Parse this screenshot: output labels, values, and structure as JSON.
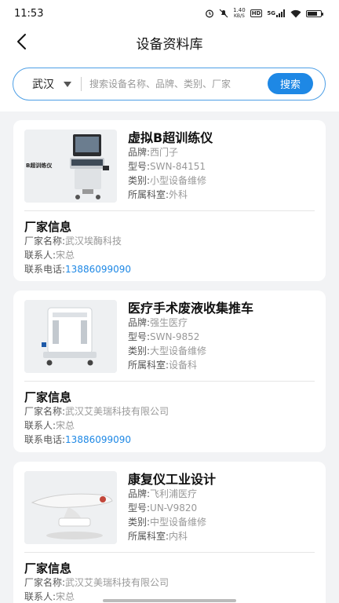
{
  "status": {
    "time": "11:53",
    "speed": "1.40",
    "speed_unit": "KB/S",
    "hd": "HD",
    "network": "5G"
  },
  "header": {
    "title": "设备资料库"
  },
  "search": {
    "city": "武汉",
    "placeholder": "搜索设备名称、品牌、类别、厂家",
    "button_label": "搜索"
  },
  "labels": {
    "brand": "品牌:",
    "model": "型号:",
    "category": "类别:",
    "department": "所属科室:",
    "vendor_section": "厂家信息",
    "vendor_name": "厂家名称:",
    "contact": "联系人:",
    "phone": "联系电话:"
  },
  "products": [
    {
      "name": "虚拟B超训练仪",
      "image_caption": "B超训练仪",
      "brand": "西门子",
      "model": "SWN-84151",
      "category": "小型设备维修",
      "department": "外科",
      "vendor": {
        "name": "武汉埃酶科技",
        "contact": "宋总",
        "phone": "13886099090"
      }
    },
    {
      "name": "医疗手术废液收集推车",
      "brand": "强生医疗",
      "model": "SWN-9852",
      "category": "大型设备维修",
      "department": "设备科",
      "vendor": {
        "name": "武汉艾美瑞科技有限公司",
        "contact": "宋总",
        "phone": "13886099090"
      }
    },
    {
      "name": "康复仪工业设计",
      "brand": "飞利浦医疗",
      "model": "UN-V9820",
      "category": "中型设备维修",
      "department": "内科",
      "vendor": {
        "name": "武汉艾美瑞科技有限公司",
        "contact": "宋总"
      }
    }
  ]
}
